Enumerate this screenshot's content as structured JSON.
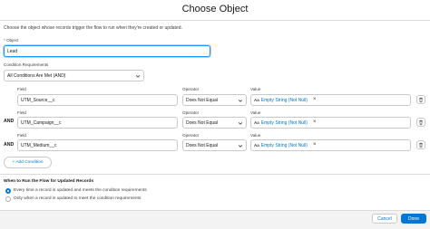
{
  "dialog": {
    "title": "Choose Object",
    "description": "Choose the object whose records trigger the flow to run when they're created or updated."
  },
  "object": {
    "label": "Object",
    "required_mark": "*",
    "value": "Lead"
  },
  "conditions": {
    "label": "Condition Requirements",
    "selected": "All Conditions Are Met (AND)",
    "column_labels": {
      "field": "Field",
      "operator": "Operator",
      "value": "Value"
    },
    "rows": [
      {
        "connector": "",
        "field": "UTM_Source__c",
        "operator": "Does Not Equal",
        "value": "Empty String (Not Null)",
        "remove": "×"
      },
      {
        "connector": "AND",
        "field": "UTM_Campaign__c",
        "operator": "Does Not Equal",
        "value": "Empty String (Not Null)",
        "remove": "×"
      },
      {
        "connector": "AND",
        "field": "UTM_Medium__c",
        "operator": "Does Not Equal",
        "value": "Empty String (Not Null)",
        "remove": "×"
      }
    ],
    "value_icon": "Aa",
    "add_label": "+ Add Condition"
  },
  "run_when": {
    "title": "When to Run the Flow for Updated Records",
    "options": [
      {
        "label": "Every time a record is updated and meets the condition requirements",
        "selected": true
      },
      {
        "label": "Only when a record is updated to meet the condition requirements",
        "selected": false
      }
    ]
  },
  "footer": {
    "cancel_label": "Cancel",
    "done_label": "Done"
  },
  "colors": {
    "brand": "#0176d3",
    "focus": "#1b96ff",
    "border": "#c9c9c9"
  }
}
